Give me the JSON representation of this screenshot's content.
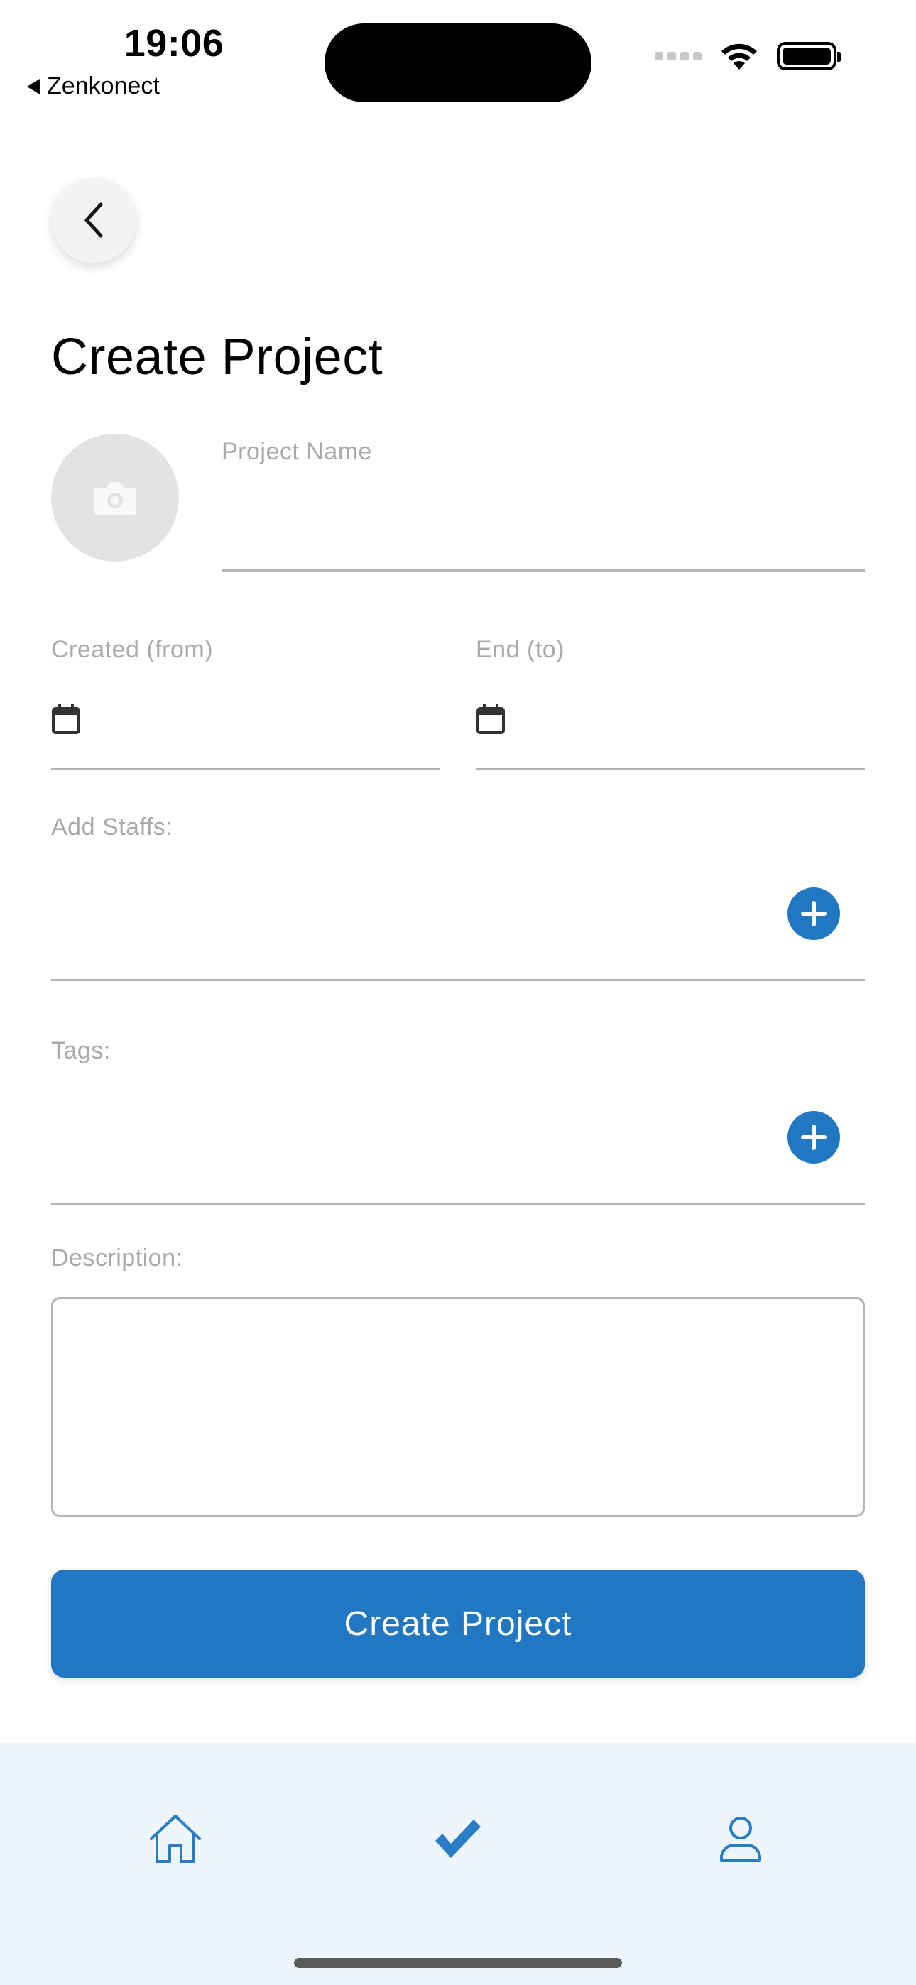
{
  "status_bar": {
    "time": "19:06",
    "back_app_label": "Zenkonect"
  },
  "header": {
    "title": "Create Project"
  },
  "form": {
    "project_name_label": "Project Name",
    "project_name_value": "",
    "created_from_label": "Created (from)",
    "end_to_label": "End (to)",
    "add_staffs_label": "Add Staffs:",
    "tags_label": "Tags:",
    "description_label": "Description:",
    "description_value": ""
  },
  "actions": {
    "create_label": "Create Project"
  },
  "tabbar": {
    "tabs": [
      "home-icon",
      "check-icon",
      "profile-icon"
    ],
    "active": "check-icon"
  },
  "colors": {
    "accent": "#2277c2",
    "tabbar_bg": "#eef5fc",
    "label_gray": "#a9a9a9"
  }
}
